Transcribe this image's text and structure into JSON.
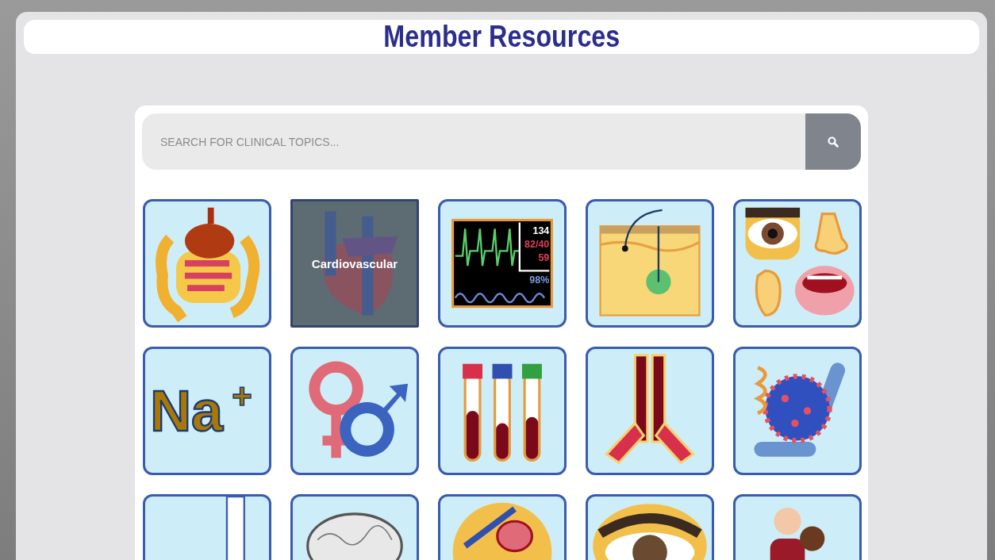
{
  "header": {
    "title": "Member Resources"
  },
  "search": {
    "placeholder": "SEARCH FOR CLINICAL TOPICS..."
  },
  "tiles": [
    {
      "kind": "digestive",
      "hovered": false
    },
    {
      "kind": "heart",
      "hovered": true,
      "label": "Cardiovascular"
    },
    {
      "kind": "monitor",
      "hovered": false,
      "readings": [
        "134",
        "82/40",
        "59",
        "98%"
      ]
    },
    {
      "kind": "skin",
      "hovered": false
    },
    {
      "kind": "senses",
      "hovered": false
    },
    {
      "kind": "sodium",
      "hovered": false,
      "symbol": "Na",
      "charge": "+"
    },
    {
      "kind": "sexes",
      "hovered": false
    },
    {
      "kind": "tubes",
      "hovered": false
    },
    {
      "kind": "antibody",
      "hovered": false
    },
    {
      "kind": "virus",
      "hovered": false
    },
    {
      "kind": "bar",
      "hovered": false
    },
    {
      "kind": "brain",
      "hovered": false
    },
    {
      "kind": "organ",
      "hovered": false
    },
    {
      "kind": "eye",
      "hovered": false
    },
    {
      "kind": "people",
      "hovered": false
    }
  ]
}
